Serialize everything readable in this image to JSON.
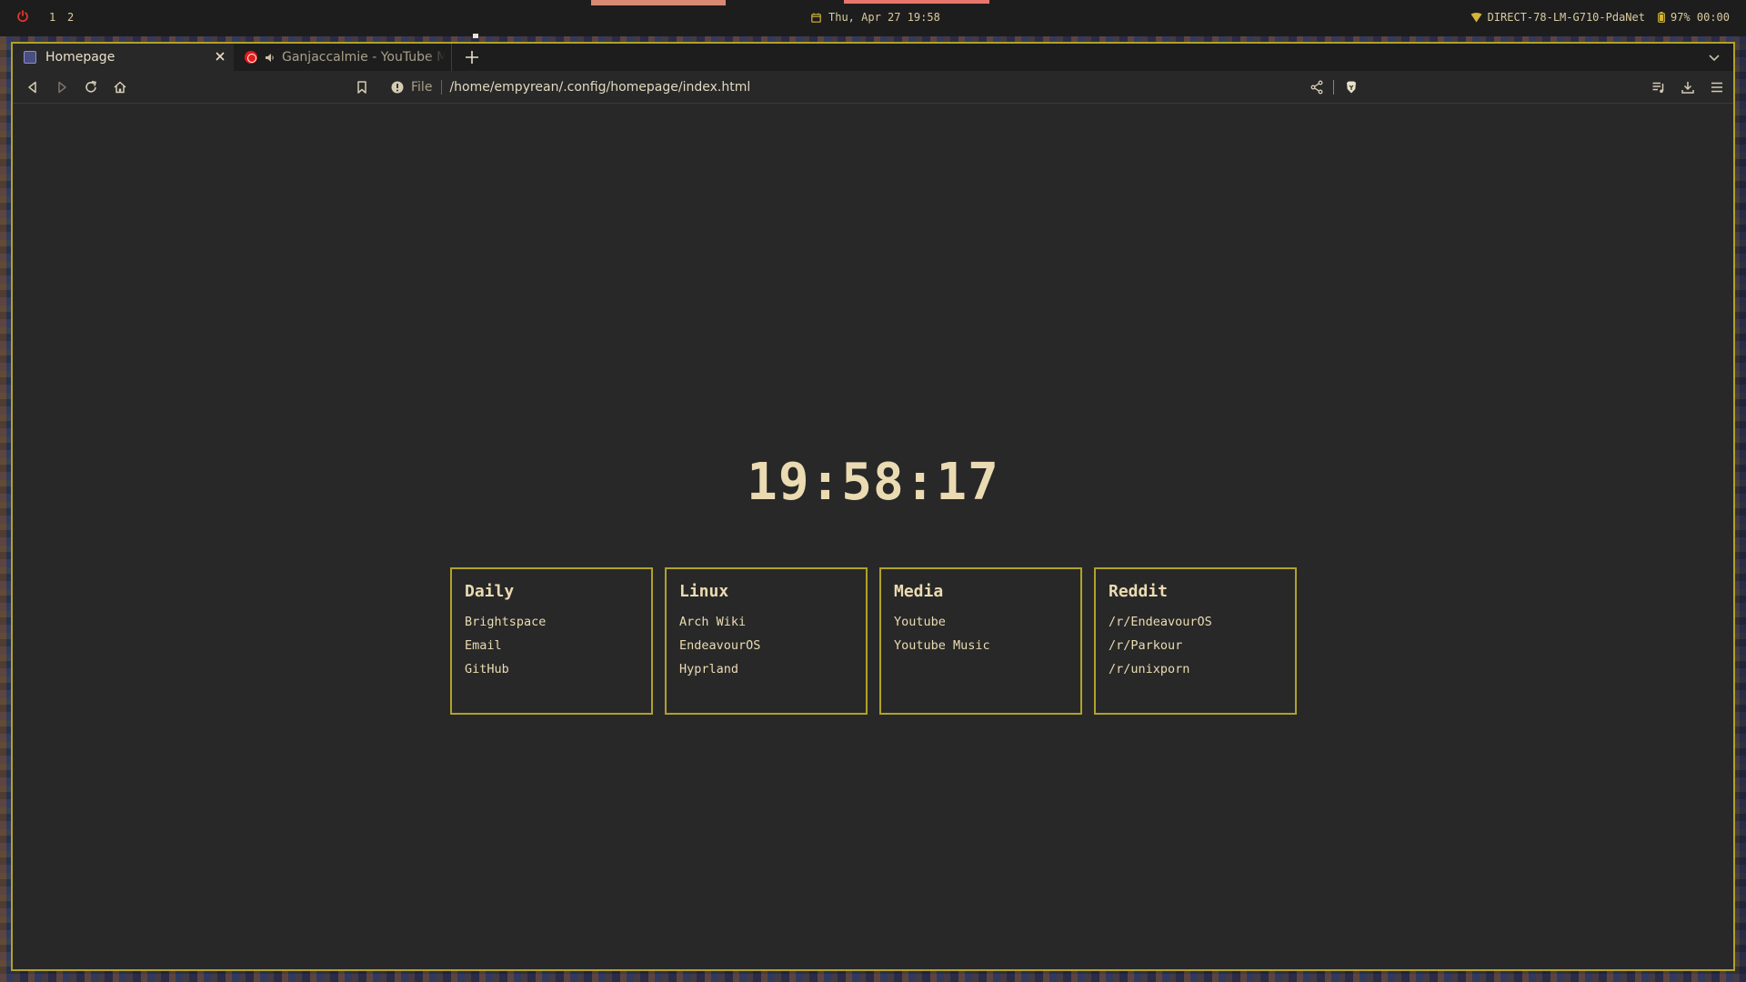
{
  "statusbar": {
    "workspaces": [
      "1",
      "2"
    ],
    "datetime": "Thu, Apr 27 19:58",
    "network": "DIRECT-78-LM-G710-PdaNet",
    "battery": "97% 00:00"
  },
  "browser": {
    "tabs": [
      {
        "label": "Homepage",
        "active": true
      },
      {
        "label": "Ganjaccalmie - YouTube Music",
        "active": false
      }
    ],
    "toolbar": {
      "scheme": "File",
      "url": "/home/empyrean/.config/homepage/index.html"
    }
  },
  "page": {
    "clock": "19:58:17",
    "cards": [
      {
        "title": "Daily",
        "links": [
          "Brightspace",
          "Email",
          "GitHub"
        ]
      },
      {
        "title": "Linux",
        "links": [
          "Arch Wiki",
          "EndeavourOS",
          "Hyprland"
        ]
      },
      {
        "title": "Media",
        "links": [
          "Youtube",
          "Youtube Music"
        ]
      },
      {
        "title": "Reddit",
        "links": [
          "/r/EndeavourOS",
          "/r/Parkour",
          "/r/unixporn"
        ]
      }
    ]
  },
  "colors": {
    "accent": "#b0a22b",
    "text": "#ebdbb2",
    "background": "#282828",
    "bar": "#1d1d1d"
  }
}
